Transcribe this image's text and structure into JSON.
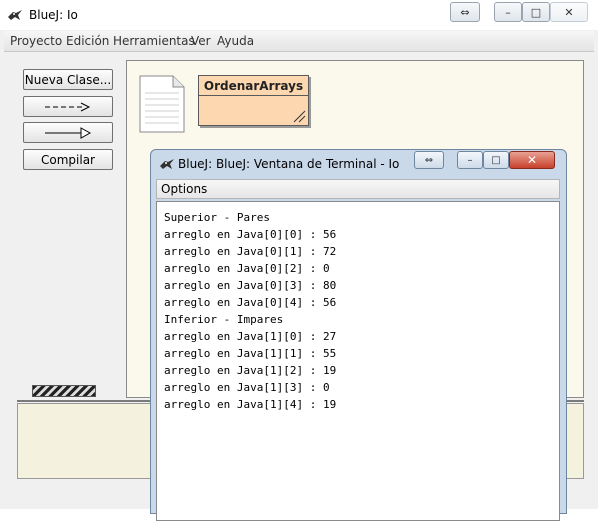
{
  "window": {
    "title": "BlueJ:  Io",
    "restore_glyph": "⇔",
    "min_glyph": "–",
    "max_glyph": "□",
    "close_glyph": "✕"
  },
  "menubar": [
    "Proyecto",
    "Edición",
    "Herramientas",
    "Ver",
    "Ayuda"
  ],
  "sidebar": {
    "new_class_label": "Nueva Clase...",
    "dependency_arrow": "- - ->",
    "inheritance_arrow": "——▷",
    "compile_label": "Compilar"
  },
  "diagram": {
    "class_name": "OrdenarArrays"
  },
  "terminal": {
    "title": "BlueJ: BlueJ:  Ventana de Terminal - Io",
    "menu_label": "Options",
    "restore_glyph": "⇔",
    "min_glyph": "–",
    "max_glyph": "□",
    "close_glyph": "✕",
    "lines": [
      "Superior - Pares",
      "arreglo en Java[0][0] : 56",
      "arreglo en Java[0][1] : 72",
      "arreglo en Java[0][2] : 0",
      "arreglo en Java[0][3] : 80",
      "arreglo en Java[0][4] : 56",
      "Inferior - Impares",
      "arreglo en Java[1][0] : 27",
      "arreglo en Java[1][1] : 55",
      "arreglo en Java[1][2] : 19",
      "arreglo en Java[1][3] : 0",
      "arreglo en Java[1][4] : 19"
    ]
  },
  "colors": {
    "class_fill": "#fcd7b0",
    "canvas_bg": "#fbf8ec",
    "terminal_frame": "#c9d9ea",
    "close_red": "#c8412c"
  }
}
